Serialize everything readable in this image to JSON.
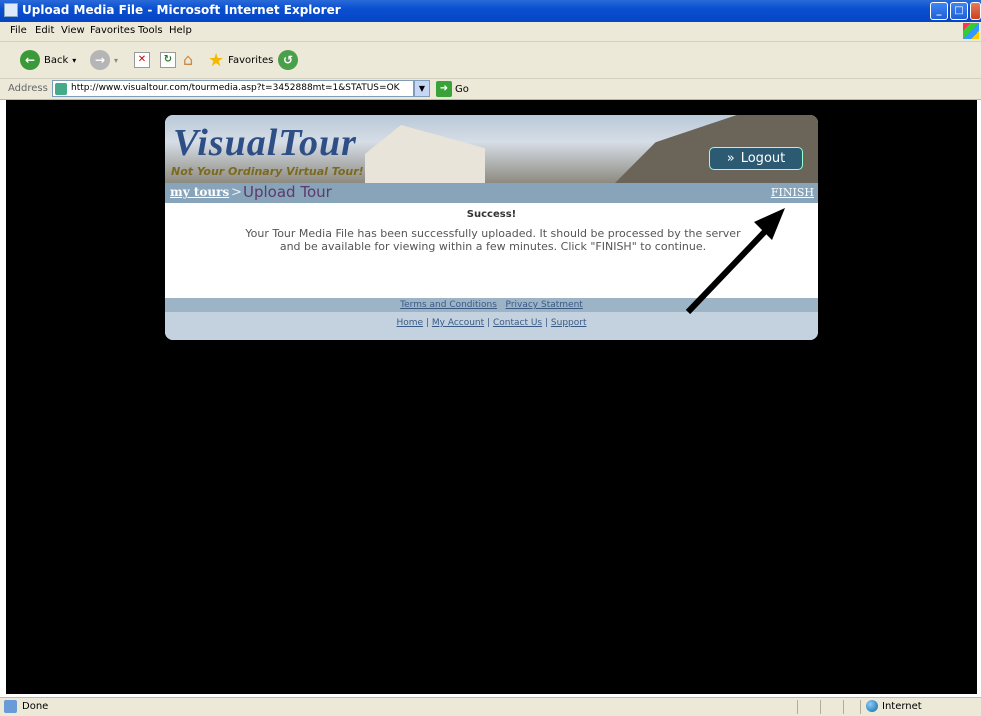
{
  "window": {
    "title": "Upload Media File - Microsoft Internet Explorer",
    "buttons": {
      "minimize": "_",
      "maximize": "□",
      "close": "✕"
    }
  },
  "menu": [
    "File",
    "Edit",
    "View",
    "Favorites",
    "Tools",
    "Help"
  ],
  "toolbar": {
    "back_label": "Back",
    "favorites_label": "Favorites"
  },
  "address": {
    "label": "Address",
    "url": "http://www.visualtour.com/tourmedia.asp?t=3452888mt=1&STATUS=OK",
    "go_label": "Go"
  },
  "page": {
    "logo_text": "VisualTour",
    "tagline": "Not Your Ordinary Virtual Tour!",
    "logout_label": "Logout",
    "breadcrumb": {
      "my_tours": "my tours",
      "separator": ">",
      "current": "Upload Tour",
      "finish": "FINISH"
    },
    "message": {
      "heading": "Success!",
      "body": "Your Tour Media File has been successfully uploaded. It should be processed by the server and be available for viewing within a few minutes. Click \"FINISH\" to continue."
    },
    "footer": {
      "terms": "Terms and Conditions",
      "privacy": "Privacy Statment",
      "home": "Home",
      "my_account": "My Account",
      "contact": "Contact Us",
      "support": "Support",
      "pipe": "|"
    }
  },
  "status": {
    "left": "Done",
    "zone": "Internet"
  },
  "colors": {
    "titlebar": "#0a4fd0",
    "viewport": "#000000",
    "crumb_bar": "#88a4ba",
    "logout_button": "#2c5a73"
  }
}
